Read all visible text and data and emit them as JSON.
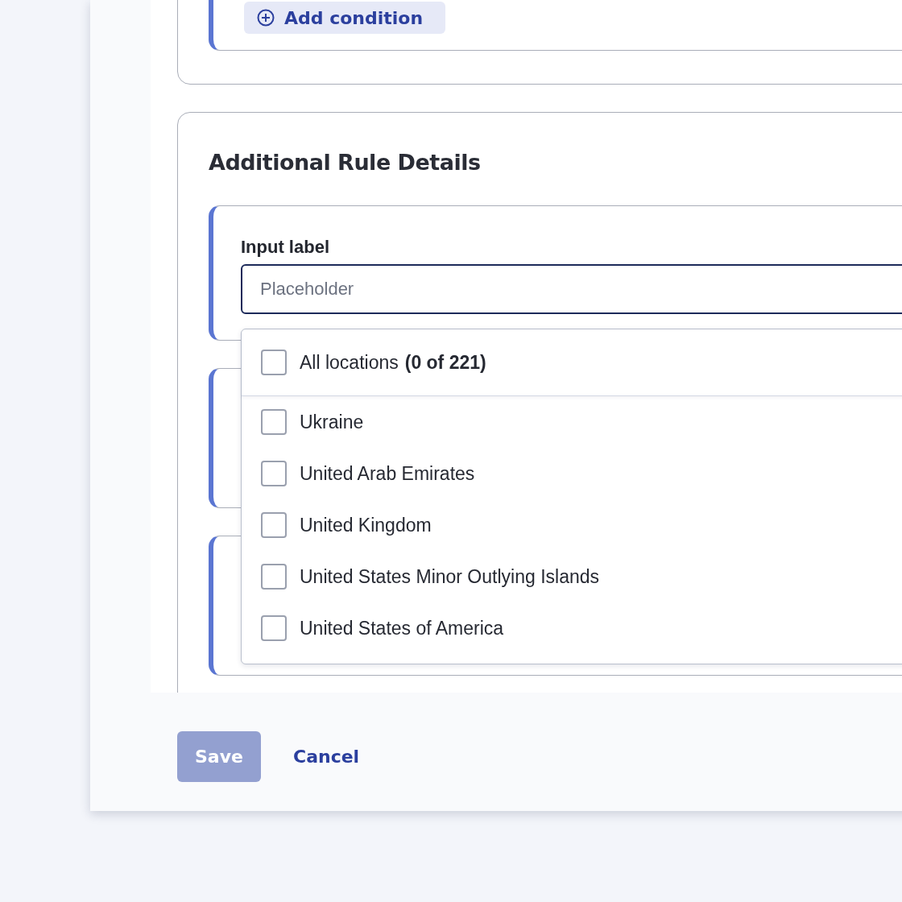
{
  "conditions_card": {
    "add_button": "Add condition"
  },
  "details_card": {
    "title": "Additional Rule Details",
    "input": {
      "label": "Input label",
      "placeholder": "Placeholder"
    },
    "dropdown": {
      "all": {
        "label": "All locations",
        "count": "(0 of 221)",
        "checked": false
      },
      "options": [
        {
          "label": "Ukraine",
          "checked": false
        },
        {
          "label": "United Arab Emirates",
          "checked": false
        },
        {
          "label": "United Kingdom",
          "checked": false
        },
        {
          "label": "United States Minor Outlying Islands",
          "checked": false
        },
        {
          "label": "United States of America",
          "checked": false
        }
      ]
    }
  },
  "footer": {
    "save": {
      "label": "Save",
      "disabled": true
    },
    "cancel": "Cancel"
  }
}
